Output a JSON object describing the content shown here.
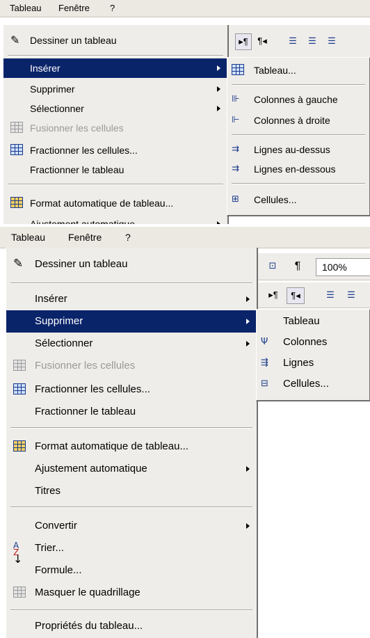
{
  "top": {
    "menubar": [
      "Tableau",
      "Fenêtre",
      "?"
    ],
    "toolbar_buttons": [
      "▸¶",
      "¶◂",
      "☰",
      "☰",
      "☰"
    ],
    "menu": [
      {
        "label": "Dessiner un tableau",
        "icon": "pencil-icon",
        "state": "normal"
      },
      {
        "label": "Insérer",
        "state": "highlighted",
        "submenu": true
      },
      {
        "label": "Supprimer",
        "state": "normal",
        "submenu": true
      },
      {
        "label": "Sélectionner",
        "state": "normal",
        "submenu": true
      },
      {
        "label": "Fusionner les cellules",
        "icon": "merge-cells-icon",
        "state": "disabled"
      },
      {
        "label": "Fractionner les cellules...",
        "icon": "split-cells-icon",
        "state": "normal"
      },
      {
        "label": "Fractionner le tableau",
        "state": "normal"
      },
      {
        "label": "Format automatique de tableau...",
        "icon": "autoformat-icon",
        "state": "normal"
      },
      {
        "label": "Ajustement automatique",
        "state": "partially-hidden",
        "submenu": true
      }
    ],
    "submenu": [
      {
        "label": "Tableau...",
        "icon": "table-icon"
      },
      {
        "label": "Colonnes à gauche",
        "icon": "insert-column-left-icon"
      },
      {
        "label": "Colonnes à droite",
        "icon": "insert-column-right-icon"
      },
      {
        "label": "Lignes au-dessus",
        "icon": "insert-row-above-icon"
      },
      {
        "label": "Lignes en-dessous",
        "icon": "insert-row-below-icon"
      },
      {
        "label": "Cellules...",
        "icon": "insert-cells-icon"
      }
    ]
  },
  "bottom": {
    "menubar": [
      "Tableau",
      "Fenêtre",
      "?"
    ],
    "zoom": "100%",
    "menu": [
      {
        "label": "Dessiner un tableau",
        "icon": "pencil-icon",
        "state": "normal"
      },
      {
        "label": "Insérer",
        "state": "normal",
        "submenu": true
      },
      {
        "label": "Supprimer",
        "state": "highlighted",
        "submenu": true
      },
      {
        "label": "Sélectionner",
        "state": "normal",
        "submenu": true
      },
      {
        "label": "Fusionner les cellules",
        "icon": "merge-cells-icon",
        "state": "disabled"
      },
      {
        "label": "Fractionner les cellules...",
        "icon": "split-cells-icon",
        "state": "normal"
      },
      {
        "label": "Fractionner le tableau",
        "state": "normal"
      },
      {
        "label": "Format automatique de tableau...",
        "icon": "autoformat-icon",
        "state": "normal"
      },
      {
        "label": "Ajustement automatique",
        "state": "normal",
        "submenu": true
      },
      {
        "label": "Titres",
        "state": "normal"
      },
      {
        "label": "Convertir",
        "state": "normal",
        "submenu": true
      },
      {
        "label": "Trier...",
        "icon": "sort-az-icon",
        "state": "normal"
      },
      {
        "label": "Formule...",
        "state": "normal"
      },
      {
        "label": "Masquer le quadrillage",
        "icon": "gridlines-icon",
        "state": "normal"
      },
      {
        "label": "Propriétés du tableau...",
        "state": "normal"
      }
    ],
    "submenu": [
      {
        "label": "Tableau",
        "icon": ""
      },
      {
        "label": "Colonnes",
        "icon": "delete-column-icon"
      },
      {
        "label": "Lignes",
        "icon": "delete-row-icon"
      },
      {
        "label": "Cellules...",
        "icon": "delete-cells-icon"
      }
    ]
  }
}
